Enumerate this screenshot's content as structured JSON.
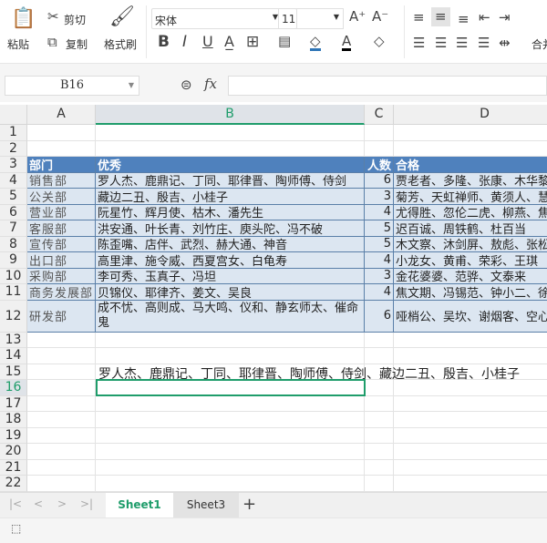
{
  "toolbar": {
    "paste": "粘贴",
    "cut": "剪切",
    "copy": "复制",
    "format_painter": "格式刷",
    "font_name": "宋体",
    "font_size": "11",
    "merge": "合并",
    "icons": [
      "paste-icon",
      "cut-icon",
      "copy-icon",
      "format-painter-icon",
      "bold-icon",
      "italic-icon",
      "underline-icon",
      "strikethrough-icon",
      "borders-icon",
      "cell-style-icon",
      "fill-color-icon",
      "font-color-icon",
      "clear-icon",
      "increase-font-icon",
      "decrease-font-icon",
      "align-top-icon",
      "align-middle-icon",
      "align-bottom-icon",
      "indent-decrease-icon",
      "indent-increase-icon",
      "align-left-icon",
      "align-center-icon",
      "align-right-icon",
      "justify-icon",
      "distribute-icon"
    ]
  },
  "formula_bar": {
    "cell_ref": "B16",
    "fx": "fx",
    "value": ""
  },
  "columns": [
    "A",
    "B",
    "C",
    "D"
  ],
  "selected_column": "B",
  "rows": [
    "1",
    "2",
    "3",
    "4",
    "5",
    "6",
    "7",
    "8",
    "9",
    "10",
    "11",
    "12",
    "13",
    "14",
    "15",
    "16",
    "17",
    "18",
    "19",
    "20",
    "21",
    "22"
  ],
  "selected_row": "16",
  "table": {
    "headers": [
      "部门",
      "优秀",
      "人数",
      "合格"
    ],
    "data": [
      [
        "销售部",
        "罗人杰、鹿鼎记、丁同、耶律晋、陶师傅、侍剑",
        "6",
        "贾老者、多隆、张康、木华黎"
      ],
      [
        "公关部",
        "藏边二丑、殷吉、小桂子",
        "3",
        "菊芳、天虹禅师、黄须人、慧"
      ],
      [
        "营业部",
        "阮星竹、辉月使、枯木、潘先生",
        "4",
        "尤得胜、忽伦二虎、柳燕、焦"
      ],
      [
        "客服部",
        "洪安通、叶长青、刘竹庄、庾头陀、冯不破",
        "5",
        "迟百诚、周铁鹤、杜百当"
      ],
      [
        "宣传部",
        "陈歪嘴、店伴、武烈、赫大通、神音",
        "5",
        "木文察、沐剑屏、敖彪、张松"
      ],
      [
        "出口部",
        "高里津、施令威、西夏宫女、白龟寿",
        "4",
        "小龙女、黄甫、荣彩、王琪"
      ],
      [
        "采购部",
        "李可秀、玉真子、冯坦",
        "3",
        "金花婆婆、范骅、文泰来"
      ],
      [
        "商务发展部",
        "贝锦仪、耶律齐、姜文、吴良",
        "4",
        "焦文期、冯锡范、钟小二、徐"
      ],
      [
        "研发部",
        "成不忧、高则成、马大鸣、仪和、静玄师太、催命鬼",
        "6",
        "哑梢公、吴坎、谢烟客、空心"
      ]
    ]
  },
  "row15_text": "罗人杰、鹿鼎记、丁同、耶律晋、陶师傅、侍剑、藏边二丑、殷吉、小桂子",
  "sheets": {
    "active": "Sheet1",
    "other": "Sheet3",
    "add": "+"
  },
  "nav": {
    "first": "|<",
    "prev": "<",
    "next": ">",
    "last": ">|"
  },
  "colors": {
    "accent": "#1f9d6b",
    "header_fill": "#4f81bd",
    "body_fill": "#dce6f1"
  }
}
